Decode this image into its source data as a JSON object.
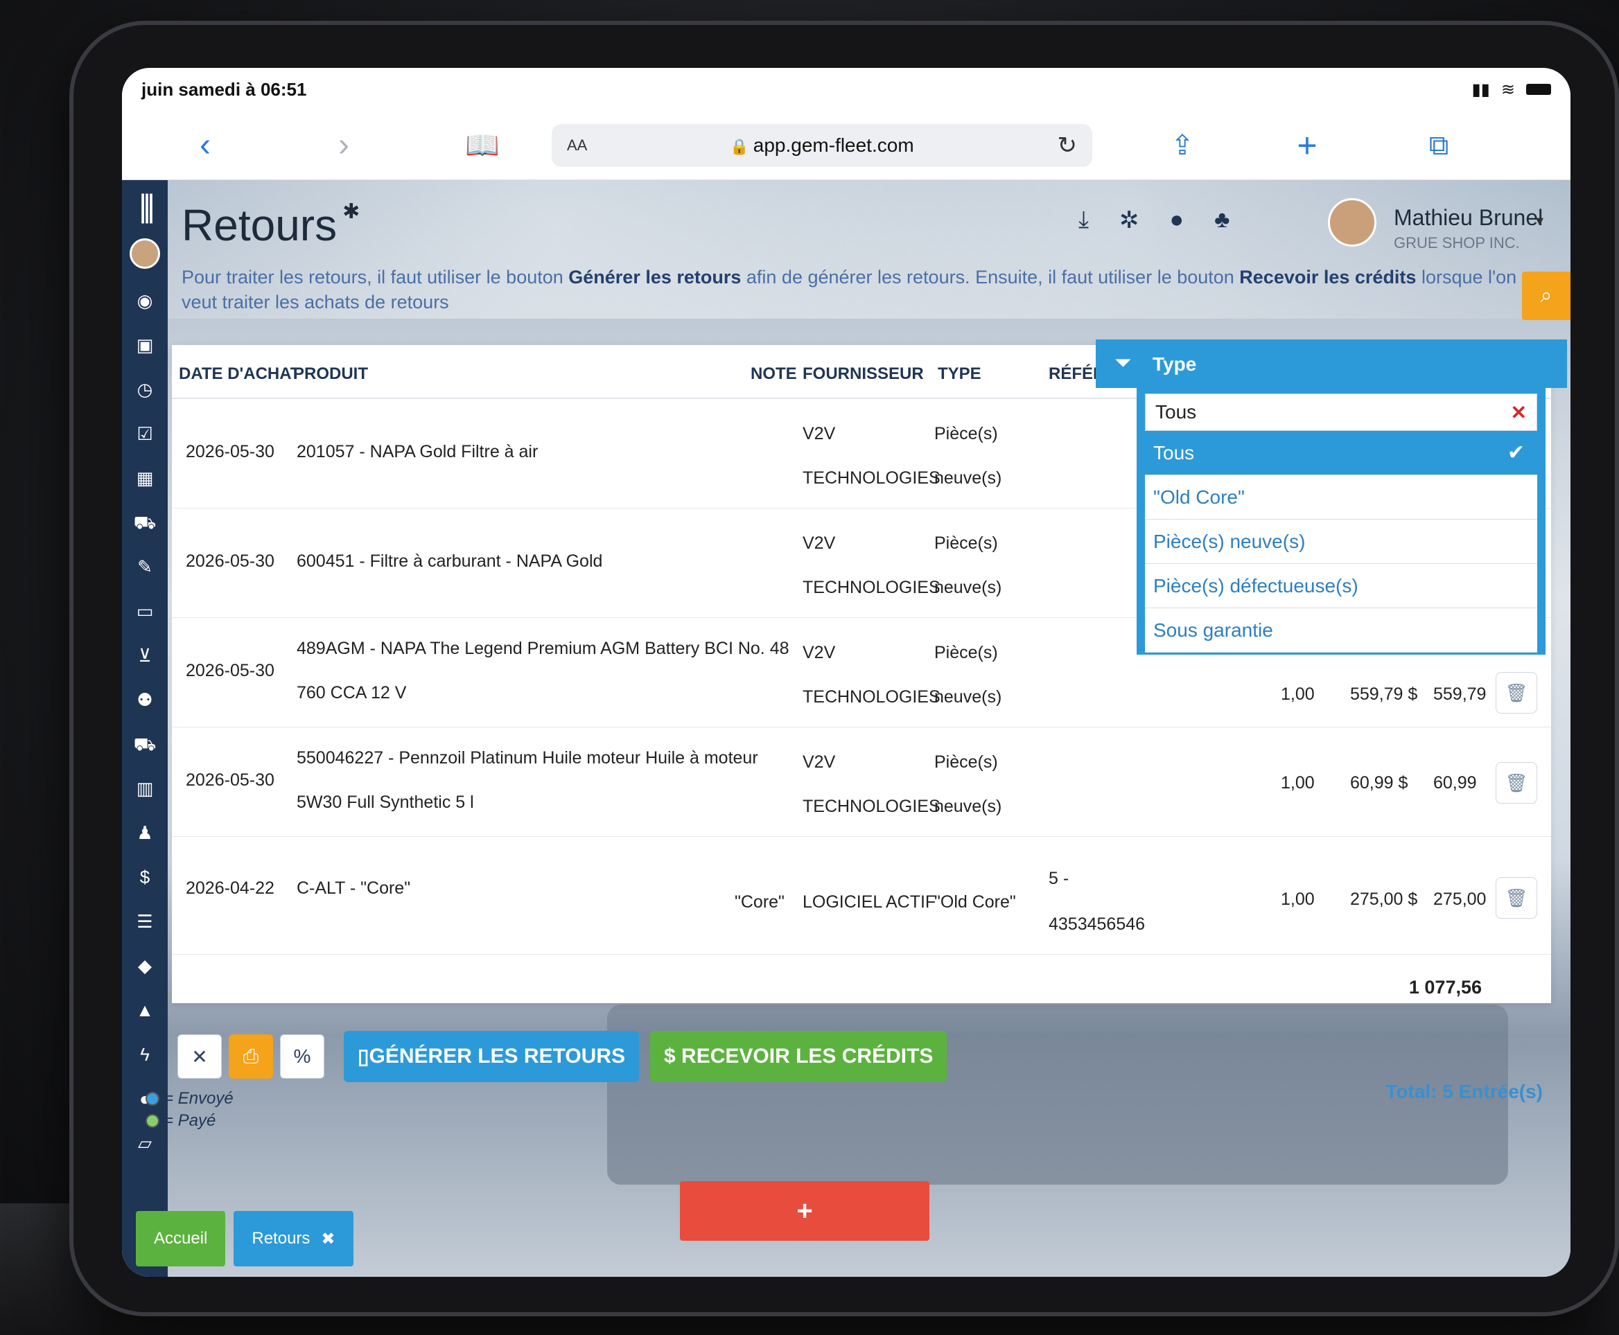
{
  "status": {
    "time": "juin samedi à 06:51"
  },
  "browser": {
    "aa": "AA",
    "url": "app.gem-fleet.com"
  },
  "page": {
    "title": "Retours",
    "intro_1": "Pour traiter les retours, il faut utiliser le bouton ",
    "intro_bold_1": "Générer les retours",
    "intro_2": " afin de générer les retours. Ensuite, il faut utiliser le bouton ",
    "intro_bold_2": "Recevoir les crédits",
    "intro_3": " lorsque l'on veut traiter les achats de retours"
  },
  "user": {
    "name": "Mathieu Brunel",
    "company": "GRUE SHOP INC."
  },
  "table": {
    "headers": {
      "date": "DATE D'ACHAT",
      "product": "PRODUIT",
      "note": "NOTE",
      "supplier": "FOURNISSEUR",
      "type": "TYPE",
      "reference": "RÉFÉREN"
    },
    "rows": [
      {
        "date": "2026-05-30",
        "product_l1": "201057 - NAPA Gold Filtre à air",
        "product_l2": "",
        "note": "",
        "supplier_l1": "V2V",
        "supplier_l2": "TECHNOLOGIES",
        "type_l1": "Pièce(s)",
        "type_l2": "neuve(s)",
        "ref_l1": "",
        "ref_l2": "",
        "qty": "",
        "price": "",
        "total": ""
      },
      {
        "date": "2026-05-30",
        "product_l1": "600451 - Filtre à carburant - NAPA Gold",
        "product_l2": "",
        "note": "",
        "supplier_l1": "V2V",
        "supplier_l2": "TECHNOLOGIES",
        "type_l1": "Pièce(s)",
        "type_l2": "neuve(s)",
        "ref_l1": "",
        "ref_l2": "",
        "qty": "",
        "price": "",
        "total": ""
      },
      {
        "date": "2026-05-30",
        "product_l1": "489AGM - NAPA The Legend Premium AGM Battery BCI No. 48",
        "product_l2": "760 CCA 12 V",
        "note": "",
        "supplier_l1": "V2V",
        "supplier_l2": "TECHNOLOGIES",
        "type_l1": "Pièce(s)",
        "type_l2": "neuve(s)",
        "ref_l1": "",
        "ref_l2": "",
        "qty": "1,00",
        "price": "559,79 $",
        "total": "559,79"
      },
      {
        "date": "2026-05-30",
        "product_l1": "550046227 - Pennzoil Platinum Huile moteur Huile à moteur",
        "product_l2": "5W30 Full Synthetic 5 l",
        "note": "",
        "supplier_l1": "V2V",
        "supplier_l2": "TECHNOLOGIES",
        "type_l1": "Pièce(s)",
        "type_l2": "neuve(s)",
        "ref_l1": "",
        "ref_l2": "",
        "qty": "1,00",
        "price": "60,99 $",
        "total": "60,99"
      },
      {
        "date": "2026-04-22",
        "product_l1": "C-ALT - \"Core\"",
        "product_l2": "",
        "note": "\"Core\"",
        "supplier_l1": "LOGICIEL ACTIF",
        "supplier_l2": "",
        "type_l1": "\"Old Core\"",
        "type_l2": "",
        "ref_l1": "5 -",
        "ref_l2": "4353456546",
        "qty": "1,00",
        "price": "275,00 $",
        "total": "275,00"
      }
    ],
    "grand_total": "1 077,56"
  },
  "filter": {
    "title": "Type",
    "input_value": "Tous",
    "options": [
      "Tous",
      "\"Old Core\"",
      "Pièce(s) neuve(s)",
      "Pièce(s) défectueuse(s)",
      "Sous garantie"
    ],
    "selected": "Tous"
  },
  "actions": {
    "generate": "GÉNÉRER LES RETOURS",
    "receive": "$ RECEVOIR LES CRÉDITS",
    "add": "+"
  },
  "legend": {
    "sent": "= Envoyé",
    "paid": "= Payé"
  },
  "entries": "Total: 5 Entrée(s)",
  "tabs": {
    "home": "Accueil",
    "returns": "Retours"
  },
  "icons": {
    "sidebar": [
      "dashboard-icon",
      "money-icon",
      "clock-icon",
      "checkbox-icon",
      "calendar-icon",
      "car-icon",
      "edit-icon",
      "card-icon",
      "cart-icon",
      "users-icon",
      "truck-icon",
      "chart-icon",
      "user-icon",
      "dollar-icon",
      "list-icon",
      "tag-icon",
      "lock-icon",
      "bolt-icon",
      "chat-icon",
      "folder-icon"
    ]
  }
}
